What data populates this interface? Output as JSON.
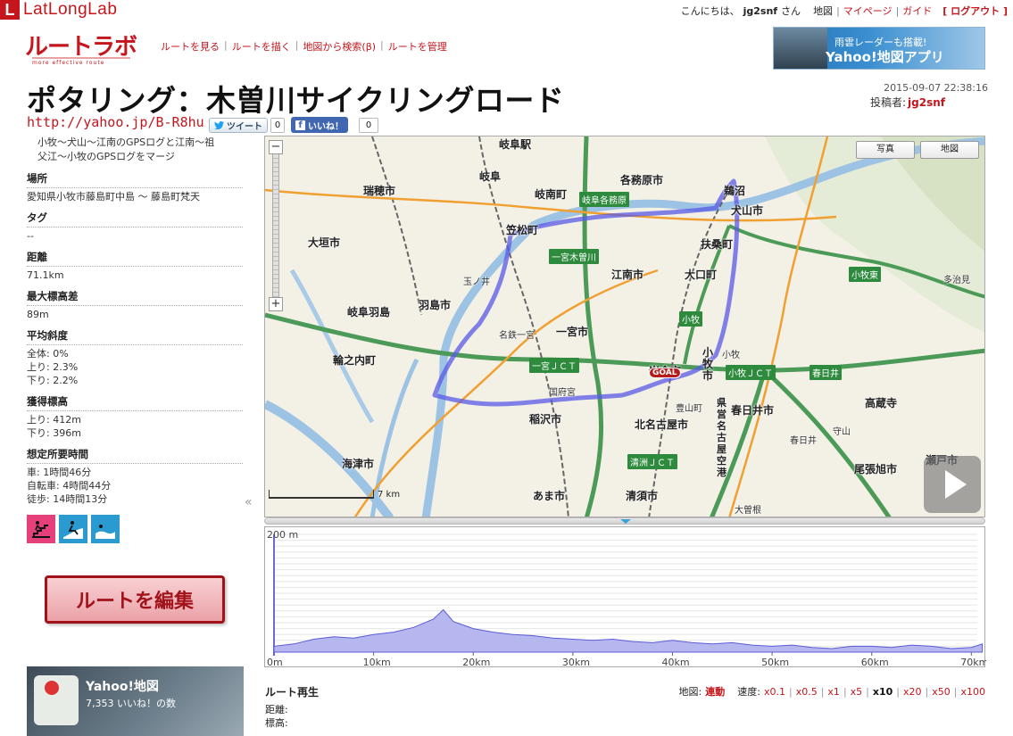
{
  "brand": {
    "latlong_letter": "L",
    "latlong_name": "LatLongLab",
    "route_logo": "ルートラボ",
    "route_sub": "more effective route"
  },
  "user_bar": {
    "greeting_prefix": "こんにちは、",
    "user": "jg2snf",
    "greeting_suffix": "さん",
    "map": "地図",
    "mypage": "マイページ",
    "guide": "ガイド",
    "logout": "[ ログアウト ]"
  },
  "nav": [
    "ルートを見る",
    "ルートを描く",
    "地図から検索(β)",
    "ルートを管理"
  ],
  "banner": {
    "line1": "雨雲レーダーも搭載!",
    "line2": "Yahoo!地図アプリ"
  },
  "route": {
    "title": "ポタリング：木曽川サイクリングロード",
    "date": "2015-09-07 22:38:16",
    "author_label": "投稿者:",
    "author": "jg2snf",
    "short_url": "http://yahoo.jp/B-R8hu"
  },
  "social": {
    "tweet": "ツイート",
    "tweet_count": "0",
    "like": "いいね！",
    "like_count": "0"
  },
  "sidebar": {
    "description_l1": "小牧〜犬山〜江南のGPSログと江南〜祖",
    "description_l2": "父江〜小牧のGPSログをマージ",
    "place_label": "場所",
    "place": "愛知県小牧市藤島町中島 〜 藤島町梵天",
    "tag_label": "タグ",
    "tag": "--",
    "distance_label": "距離",
    "distance": "71.1km",
    "maxdiff_label": "最大標高差",
    "maxdiff": "89m",
    "slope_label": "平均斜度",
    "slope_all": "全体: 0%",
    "slope_up": "上り: 2.3%",
    "slope_down": "下り: 2.2%",
    "gain_label": "獲得標高",
    "gain_up": "上り: 412m",
    "gain_down": "下り: 396m",
    "time_label": "想定所要時間",
    "time_car": "車: 1時間46分",
    "time_bike": "自転車: 4時間44分",
    "time_walk": "徒歩: 14時間13分",
    "activity_icons": [
      "walk-icon",
      "bike-icon",
      "swim-icon"
    ],
    "collapse": "«",
    "edit_button": "ルートを編集"
  },
  "app_ad": {
    "title": "Yahoo!地図",
    "likes": "7,353 いいね！の数"
  },
  "map": {
    "photo_btn": "写真",
    "map_btn": "地図",
    "zoom_out": "−",
    "zoom_in": "+",
    "scale": "7 km",
    "goal": "GOAL",
    "labels": {
      "gifu_station": "岐阜駅",
      "gifu": "岐阜",
      "gifu_minami": "岐南町",
      "kakamigahara_label": "岐阜各務原",
      "kakamigahara": "各務原市",
      "unuma": "鵜沼",
      "inuyama": "犬山市",
      "mizuho": "瑞穂市",
      "ogaki": "大垣市",
      "kasamatsu": "笠松町",
      "fusou": "扶桑町",
      "ichinomiya_kiso": "一宮木曽川",
      "tamanoi": "玉ノ井",
      "konan": "江南市",
      "oguchi": "大口町",
      "hashima": "羽島市",
      "gifuhashima": "岐阜羽島",
      "meitetsu_ichinomiya": "名鉄一宮",
      "ichinomiya": "一宮市",
      "komaki": "小牧",
      "komaki_city": "小牧市",
      "komaki_jct": "小牧ＪＣＴ",
      "ichinomiya_jct": "一宮ＪＣＴ",
      "kasugai": "春日井",
      "kasugai_city": "春日井市",
      "iwakura": "岩倉市",
      "kitanagoya": "北名古屋市",
      "toyoyama": "豊山町",
      "inazawa": "稲沢市",
      "kounomiya": "国府宮",
      "kaizu": "海津市",
      "kiyosu_jct": "清洲ＪＣＴ",
      "ama": "あま市",
      "kiyosu": "清須市",
      "owariasahi": "尾張旭市",
      "seto": "瀬戸市",
      "tajimi": "多治見",
      "komaki_east": "小牧東",
      "kozoji": "高蔵寺",
      "nagoya_airport": "県営名古屋空港",
      "ozone": "大曽根",
      "kasugai_st": "春日井",
      "moriyama": "守山",
      "wajuu": "輪之内町"
    }
  },
  "elevation": {
    "y_max_label": "200 m",
    "x_ticks": [
      "0m",
      "10km",
      "20km",
      "30km",
      "40km",
      "50km",
      "60km",
      "70km"
    ],
    "y_max": 200,
    "x_max_km": 71.1,
    "profile_km": [
      0,
      2,
      4,
      6,
      8,
      10,
      12,
      14,
      16,
      17,
      18,
      19,
      20,
      22,
      24,
      26,
      28,
      30,
      32,
      34,
      36,
      38,
      40,
      42,
      44,
      46,
      48,
      50,
      52,
      54,
      56,
      58,
      60,
      62,
      64,
      66,
      68,
      70,
      71.1
    ],
    "profile_m": [
      10,
      14,
      22,
      26,
      24,
      30,
      34,
      42,
      56,
      72,
      52,
      46,
      40,
      34,
      30,
      28,
      24,
      22,
      20,
      22,
      18,
      16,
      20,
      16,
      14,
      16,
      12,
      10,
      12,
      8,
      6,
      10,
      10,
      8,
      12,
      10,
      6,
      8,
      14
    ]
  },
  "playback": {
    "title": "ルート再生",
    "distance": "距離:",
    "elevation": "標高:",
    "map_label": "地図:",
    "sync": "連動",
    "speed_label": "速度:",
    "speeds": [
      "x0.1",
      "x0.5",
      "x1",
      "x5",
      "x10",
      "x20",
      "x50",
      "x100"
    ],
    "active_speed": "x10"
  }
}
